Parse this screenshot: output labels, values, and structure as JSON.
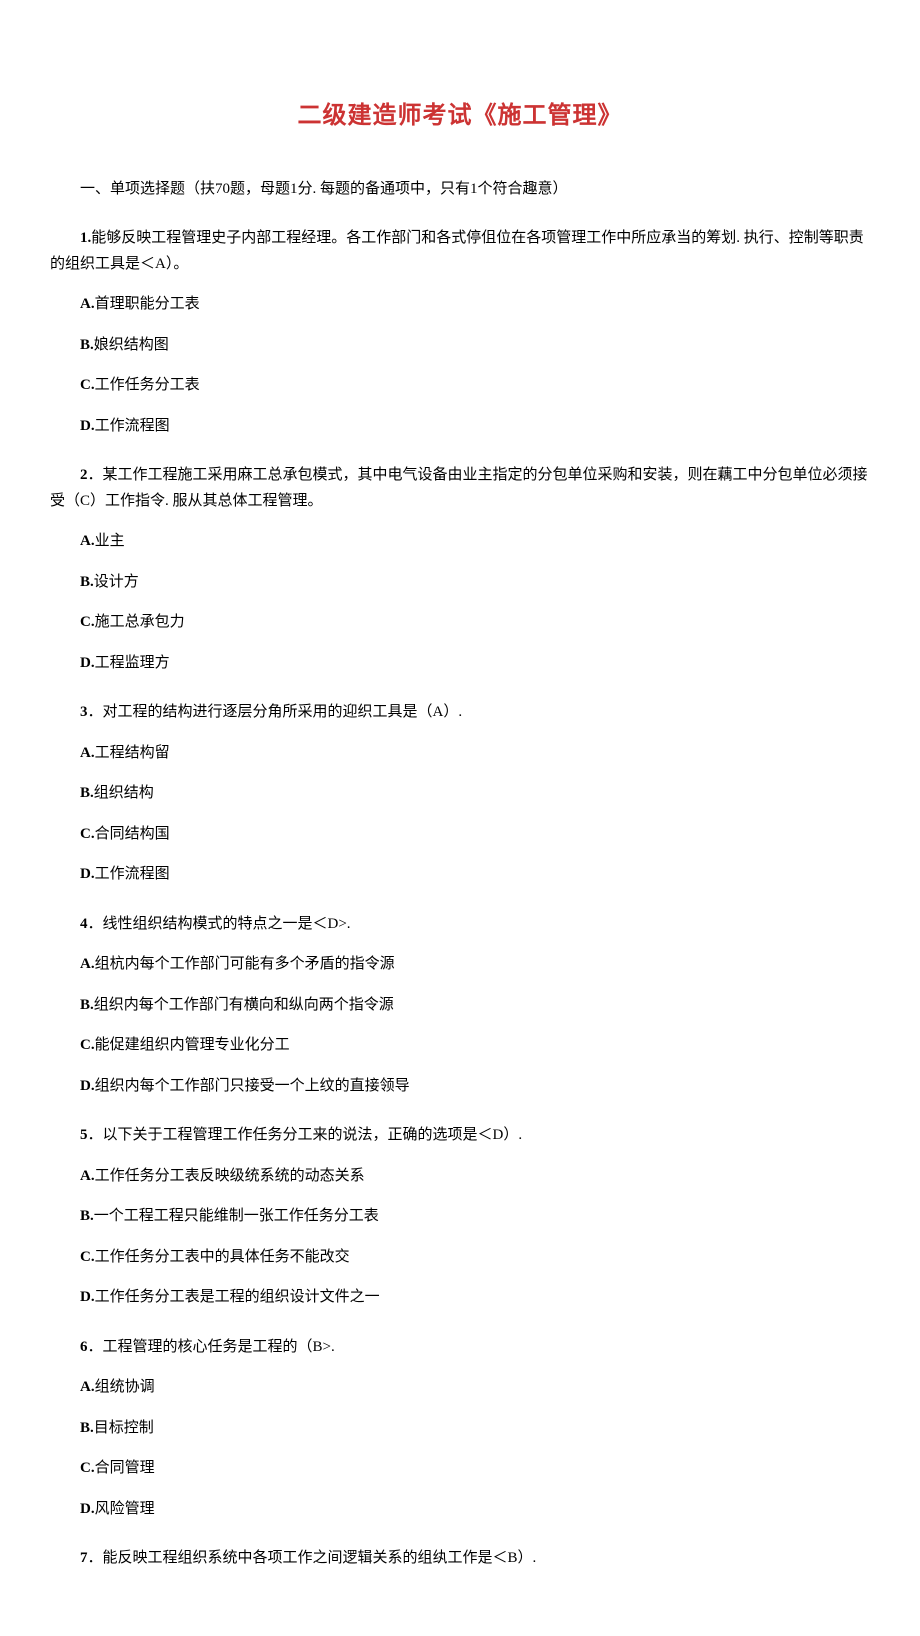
{
  "title": "二级建造师考试《施工管理》",
  "section_header": "一、单项选择题（扶70题，母题1分. 每题的备通项中，只有1个符合趣意）",
  "questions": [
    {
      "num": "1.",
      "stem": "能够反映工程管理史子内部工程经理。各工作部门和各式停伹位在各项管理工作中所应承当的筹划. 执行、控制等职责的组织工具是＜A）。",
      "options": [
        "A.首理职能分工表",
        "B.娘织结构图",
        "C.工作任务分工表",
        "D.工作流程图"
      ]
    },
    {
      "num": "2",
      "stem": "．某工作工程施工采用麻工总承包模式，其中电气设备由业主指定的分包单位采购和安装，则在藕工中分包单位必须接受（C）工作指令. 服从其总体工程管理。",
      "options": [
        "A.业主",
        "B.设计方",
        "C.施工总承包力",
        "D.工程监理方"
      ]
    },
    {
      "num": "3",
      "stem": "．对工程的结构进行逐层分角所采用的迎织工具是（A）.",
      "options": [
        "A.工程结构留",
        "B.组织结构",
        "C.合同结构国",
        "D.工作流程图"
      ]
    },
    {
      "num": "4",
      "stem": "．线性组织结构模式的特点之一是＜D>.",
      "options": [
        "A.组杭内每个工作部门可能有多个矛盾的指令源",
        "B.组织内每个工作部门有横向和纵向两个指令源",
        "C.能促建组织内管理专业化分工",
        "D.组织内每个工作部门只接受一个上纹的直接领导"
      ]
    },
    {
      "num": "5",
      "stem": "．以下关于工程管理工作任务分工来的说法，正确的选项是＜D）.",
      "options": [
        "A.工作任务分工表反映级统系统的动态关系",
        "B.一个工程工程只能维制一张工作任务分工表",
        "C.工作任务分工表中的具体任务不能改交",
        "D.工作任务分工表是工程的组织设计文件之一"
      ]
    },
    {
      "num": "6",
      "stem": "．工程管理的核心任务是工程的（B>.",
      "options": [
        "A.组统协调",
        "B.目标控制",
        "C.合同管理",
        "D.风险管理"
      ]
    },
    {
      "num": "7",
      "stem": "．能反映工程组织系统中各项工作之间逻辑关系的组纨工作是＜B）.",
      "options": []
    }
  ]
}
